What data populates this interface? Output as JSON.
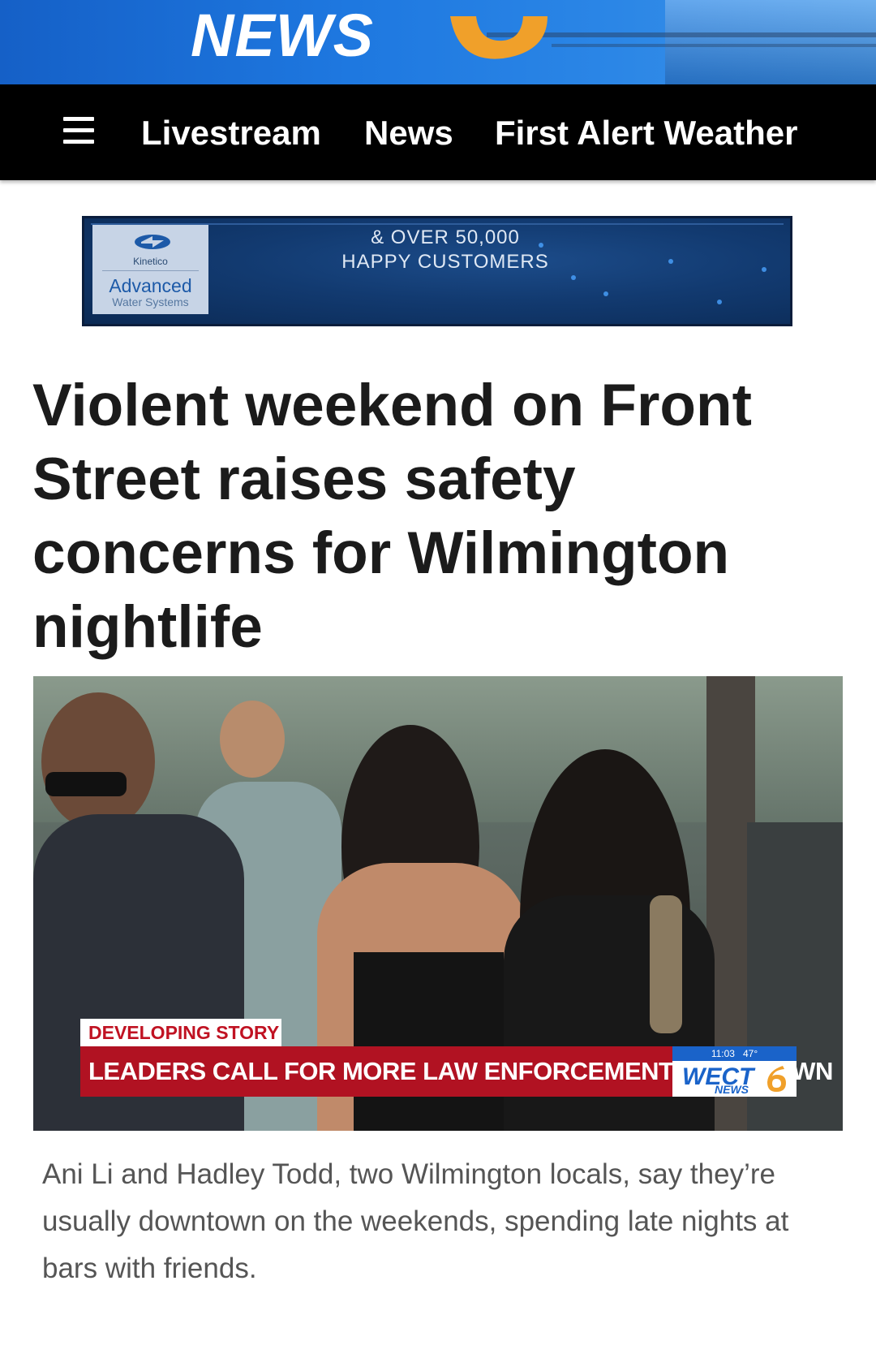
{
  "header": {
    "logo_text": "NEWS",
    "brand_color": "#1e78e0",
    "accent_color": "#f0a02a"
  },
  "nav": {
    "menu_icon": "hamburger-menu-icon",
    "items": [
      {
        "label": "Livestream"
      },
      {
        "label": "News"
      },
      {
        "label": "First Alert Weather"
      }
    ]
  },
  "ad": {
    "brand_small": "Kinetico",
    "brand_name": "Advanced",
    "brand_sub": "Water Systems",
    "line1": "& OVER 50,000",
    "line2": "HAPPY CUSTOMERS"
  },
  "article": {
    "headline": "Violent weekend on Front Street raises safety concerns for Wilmington nightlife",
    "photo": {
      "label": "DEVELOPING STORY",
      "ticker": "LEADERS CALL FOR MORE LAW ENFORCEMENT DOWNTOWN",
      "bug_time": "11:03",
      "bug_temp": "47°",
      "bug_logo": "WECT",
      "bug_news": "NEWS"
    },
    "caption": "Ani Li and Hadley Todd, two Wilmington locals, say they’re usually downtown on the weekends, spending late nights at bars with friends."
  }
}
